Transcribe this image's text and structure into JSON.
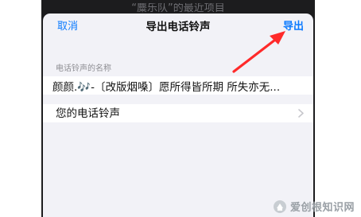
{
  "background": {
    "title": "“麋乐队”的最近项目"
  },
  "navbar": {
    "cancel_label": "取消",
    "title": "导出电话铃声",
    "export_label": "导出"
  },
  "form": {
    "name_section_label": "电话铃声的名称",
    "name_value": "颜颜.🎶-〔改版烟嗓〕愿所得皆所期 所失亦无...",
    "ringtone_row_label": "您的电话铃声"
  },
  "watermark": {
    "text": "爱创根知识网"
  },
  "colors": {
    "accent": "#0a7aff",
    "annotation_arrow": "#ff2a2a",
    "sheet_background": "#f2f2f7"
  },
  "icons": {
    "chevron": "chevron-right-icon",
    "annotation": "arrow-annotation-icon"
  }
}
